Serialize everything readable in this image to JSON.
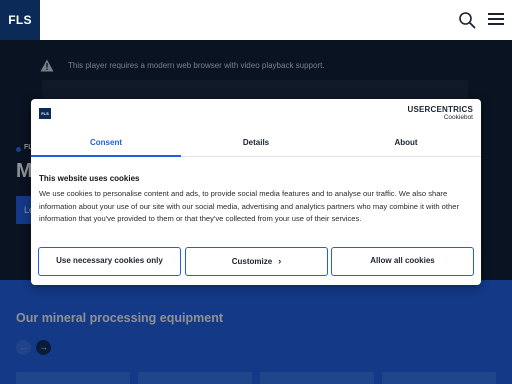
{
  "header": {
    "logo_text": "FLS",
    "search_icon": "search-icon",
    "menu_icon": "hamburger-menu-icon"
  },
  "hero": {
    "video_message": "This player requires a modern web browser with video playback support.",
    "breadcrumb": "FL",
    "title_partial": "M",
    "button_partial": "Le"
  },
  "section": {
    "title": "Our mineral processing equipment",
    "prev_icon": "arrow-left-icon",
    "next_icon": "arrow-right-icon"
  },
  "cookie_dialog": {
    "logo_text": "FLS",
    "brand_main": "USERCENTRICS",
    "brand_sub": "Cookiebot",
    "tabs": [
      {
        "label": "Consent",
        "active": true
      },
      {
        "label": "Details",
        "active": false
      },
      {
        "label": "About",
        "active": false
      }
    ],
    "heading": "This website uses cookies",
    "body": "We use cookies to personalise content and ads, to provide social media features and to analyse our traffic. We also share information about your use of our site with our social media, advertising and analytics partners who may combine it with other information that you've provided to them or that they've collected from your use of their services.",
    "buttons": {
      "necessary": "Use necessary cookies only",
      "customize": "Customize",
      "allow": "Allow all cookies"
    }
  },
  "colors": {
    "accent": "#1f5fe6",
    "brand_navy": "#0b2a57",
    "hero_bg": "#101b2c"
  }
}
